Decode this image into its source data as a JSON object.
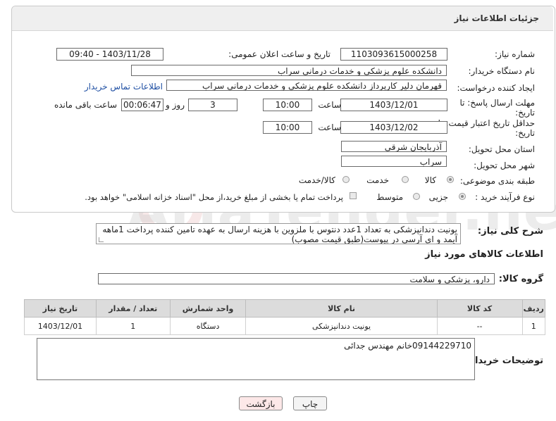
{
  "header": {
    "title": "جزئیات اطلاعات نیاز"
  },
  "form": {
    "need_number_label": "شماره نیاز:",
    "need_number": "1103093615000258",
    "announce_label": "تاریخ و ساعت اعلان عمومی:",
    "announce_value": "1403/11/28 - 09:40",
    "buyer_org_label": "نام دستگاه خریدار:",
    "buyer_org": "دانشکده علوم پزشکی و خدمات درمانی سراب",
    "creator_label": "ایجاد کننده درخواست:",
    "creator": "قهرمان دلیر کارپرداز دانشکده علوم پزشکی و خدمات درمانی سراب",
    "contact_link": "اطلاعات تماس خریدار",
    "reply_deadline_label_1": "مهلت ارسال پاسخ: تا",
    "reply_deadline_label_2": "تاریخ:",
    "reply_date": "1403/12/01",
    "time_label": "ساعت",
    "reply_time": "10:00",
    "days_value": "3",
    "days_label": "روز و",
    "remaining_time": "00:06:47",
    "remaining_label": "ساعت باقی مانده",
    "validity_label_1": "حداقل تاریخ اعتبار قیمت: تا",
    "validity_label_2": "تاریخ:",
    "validity_date": "1403/12/02",
    "validity_time": "10:00",
    "province_label": "استان محل تحویل:",
    "province": "آذربایجان شرقی",
    "city_label": "شهر محل تحویل:",
    "city": "سراب",
    "category_label": "طبقه بندی موضوعی:",
    "category_options": [
      "کالا",
      "خدمت",
      "کالا/خدمت"
    ],
    "process_label": "نوع فرآیند خرید :",
    "process_options": [
      "جزیی",
      "متوسط"
    ],
    "payment_note": "پرداخت تمام یا بخشی از مبلغ خرید،از محل \"اسناد خزانه اسلامی\" خواهد بود."
  },
  "description": {
    "label": "شرح کلی نیاز:",
    "text": "یونیت دندانپزشکی به تعداد 1عدد دنتوس با ملزوین با هزینه ارسال به عهده تامین کننده پرداخت 1ماهه آیمد و ای آرسی در پیوست(طبق قیمت مصوب)"
  },
  "goods": {
    "section_title": "اطلاعات کالاهای مورد نیاز",
    "group_label": "گروه کالا:",
    "group_value": "دارو، پزشکی و سلامت",
    "columns": [
      "ردیف",
      "کد کالا",
      "نام کالا",
      "واحد شمارش",
      "تعداد / مقدار",
      "تاریخ نیاز"
    ],
    "rows": [
      [
        "1",
        "--",
        "یونیت دندانپزشکی",
        "دستگاه",
        "1",
        "1403/12/01"
      ]
    ]
  },
  "buyer_notes": {
    "label": "توضیحات خریدار:",
    "text": "09144229710خانم مهندس جدائی"
  },
  "buttons": {
    "print": "چاپ",
    "back": "بازگشت"
  },
  "colors": {
    "link": "#1f4fa3",
    "back_button_bg": "#fde8e8",
    "table_header": "#dcdcdc"
  }
}
